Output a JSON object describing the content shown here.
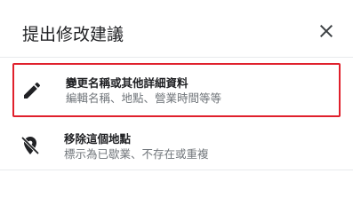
{
  "dialog": {
    "title": "提出修改建議",
    "close_icon": "close-icon"
  },
  "options": [
    {
      "icon": "pencil-icon",
      "label": "變更名稱或其他詳細資料",
      "sublabel": "編輯名稱、地點、營業時間等等",
      "highlighted": true,
      "highlight_color": "#e0202c"
    },
    {
      "icon": "location-off-icon",
      "label": "移除這個地點",
      "sublabel": "標示為已歇業、不存在或重複",
      "highlighted": false
    }
  ],
  "colors": {
    "text_primary": "#202124",
    "text_secondary": "#70757a",
    "divider": "#e8eaed",
    "highlight_border": "#e0202c"
  }
}
